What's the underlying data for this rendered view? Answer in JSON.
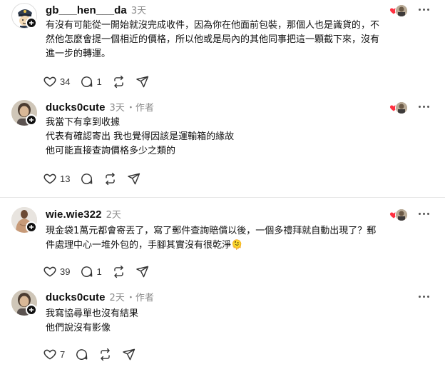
{
  "posts": [
    {
      "username": "gb___hen___da",
      "time": "3天",
      "author_tag": "",
      "lines": [
        "有沒有可能從一開始就沒完成收件，因為你在他面前包裝，那個人也是識貨的，不",
        "然他怎麼會提一個相近的價格，所以他或是局內的其他同事把這一顆截下來，沒有",
        "進一步的轉運。"
      ],
      "likes": "34",
      "comments": "1",
      "avatar_icon": "police-cartoon-avatar"
    },
    {
      "username": "ducks0cute",
      "time": "3天",
      "author_tag": "・作者",
      "lines": [
        "我當下有拿到收據",
        "代表有確認寄出 我也覺得因該是運輸箱的緣故",
        "他可能直接查詢價格多少之類的"
      ],
      "likes": "13",
      "comments": "",
      "avatar_icon": "person-photo-avatar"
    },
    {
      "username": "wie.wie322",
      "time": "2天",
      "author_tag": "",
      "lines": [
        "現金袋1萬元都會寄丟了，寫了郵件查詢賠償以後，一個多禮拜就自動出現了？郵",
        "件處理中心一堆外包的，手腳其實沒有很乾淨"
      ],
      "emoji": "🫠",
      "likes": "39",
      "comments": "1",
      "avatar_icon": "muscle-photo-avatar"
    },
    {
      "username": "ducks0cute",
      "time": "2天",
      "author_tag": "・作者",
      "lines": [
        "我寫協尋單也沒有結果",
        "他們說沒有影像"
      ],
      "likes": "7",
      "comments": "",
      "avatar_icon": "person-photo-avatar"
    }
  ],
  "colors": {
    "heart": "#ff3040",
    "muted": "#8a8a8a",
    "text": "#111111",
    "divider": "#e6e6e6"
  }
}
